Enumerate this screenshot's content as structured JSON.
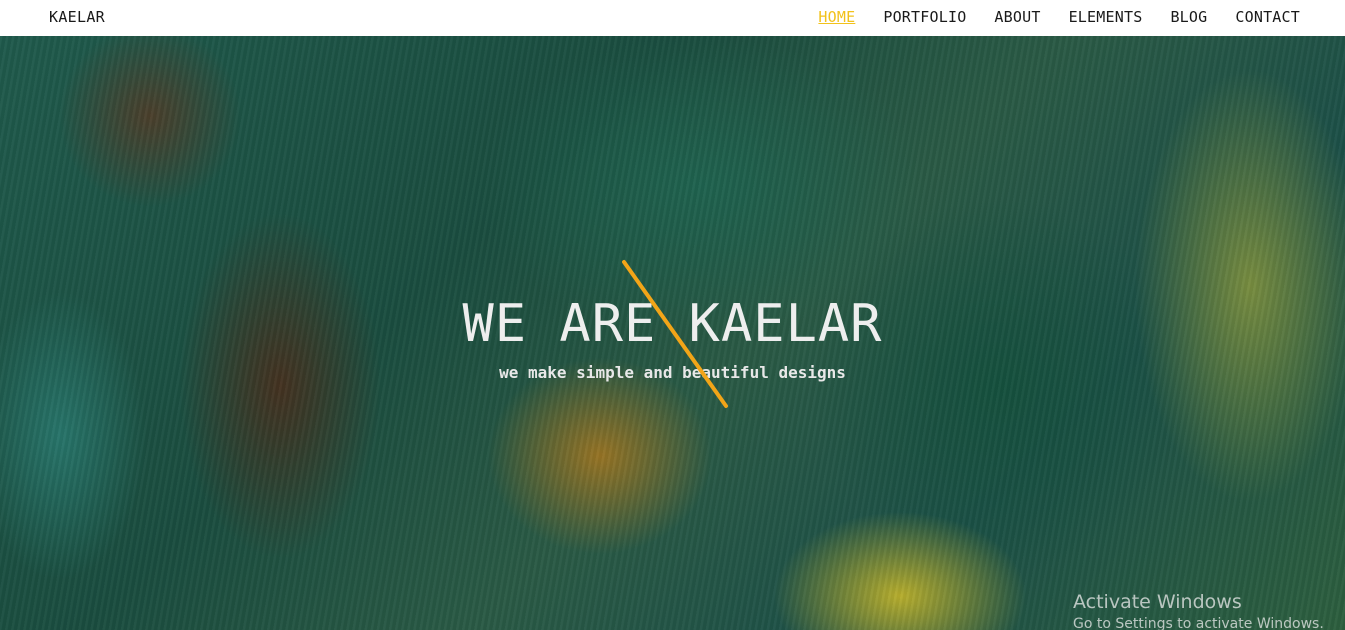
{
  "header": {
    "logo": "KAELAR",
    "nav": [
      {
        "label": "HOME",
        "active": true
      },
      {
        "label": "PORTFOLIO",
        "active": false
      },
      {
        "label": "ABOUT",
        "active": false
      },
      {
        "label": "ELEMENTS",
        "active": false
      },
      {
        "label": "BLOG",
        "active": false
      },
      {
        "label": "CONTACT",
        "active": false
      }
    ]
  },
  "hero": {
    "title": "WE ARE KAELAR",
    "subtitle": "we make simple and beautiful designs",
    "accent_color": "#f2a518"
  },
  "watermark": {
    "title": "Activate Windows",
    "subtitle": "Go to Settings to activate Windows."
  },
  "colors": {
    "nav_active": "#f2c21b",
    "nav_text": "#1a1a1a"
  }
}
